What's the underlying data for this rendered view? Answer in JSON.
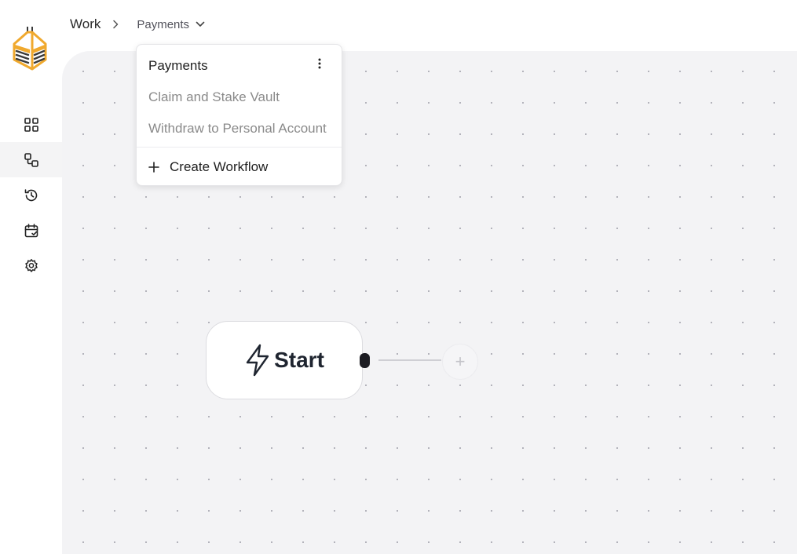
{
  "breadcrumb": {
    "root": "Work",
    "current": "Payments"
  },
  "dropdown": {
    "items": [
      {
        "label": "Payments",
        "state": "active"
      },
      {
        "label": "Claim and Stake Vault",
        "state": "muted"
      },
      {
        "label": "Withdraw to Personal Account",
        "state": "muted"
      }
    ],
    "create_label": "Create Workflow"
  },
  "sidebar": {
    "items": [
      {
        "icon": "grid-icon",
        "active": false
      },
      {
        "icon": "workflow-icon",
        "active": true
      },
      {
        "icon": "history-icon",
        "active": false
      },
      {
        "icon": "calendar-check-icon",
        "active": false
      },
      {
        "icon": "gear-icon",
        "active": false
      }
    ]
  },
  "flow": {
    "start_label": "Start",
    "add_label": "+"
  },
  "colors": {
    "brand": "#f0a92e",
    "brand_dark": "#3a3a3a",
    "canvas": "#f3f3f5",
    "text": "#1f2530"
  }
}
